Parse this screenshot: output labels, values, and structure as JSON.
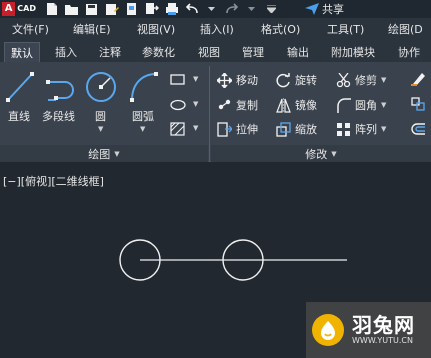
{
  "titlebar": {
    "logo_letter": "A",
    "logo_text": "CAD",
    "share_label": "共享"
  },
  "menu": [
    "文件(F)",
    "编辑(E)",
    "视图(V)",
    "插入(I)",
    "格式(O)",
    "工具(T)",
    "绘图(D"
  ],
  "tabs": [
    "默认",
    "插入",
    "注释",
    "参数化",
    "视图",
    "管理",
    "输出",
    "附加模块",
    "协作"
  ],
  "active_tab": "默认",
  "draw_panel": {
    "line": "直线",
    "polyline": "多段线",
    "circle": "圆",
    "arc": "圆弧",
    "title": "绘图"
  },
  "modify_panel": {
    "move": "移动",
    "rotate": "旋转",
    "trim": "修剪",
    "copy": "复制",
    "mirror": "镜像",
    "fillet": "圆角",
    "stretch": "拉伸",
    "scale": "缩放",
    "array": "阵列",
    "title": "修改"
  },
  "viewport": {
    "label": "[−][俯视][二维线框]"
  },
  "watermark": {
    "brand": "羽兔网",
    "url": "WWW.YUTU.CN"
  },
  "colors": {
    "background": "#212830",
    "ribbon": "#3a424d",
    "accent_blue": "#4a9eea",
    "logo_red": "#c8202a",
    "watermark_yellow": "#f0b400"
  }
}
